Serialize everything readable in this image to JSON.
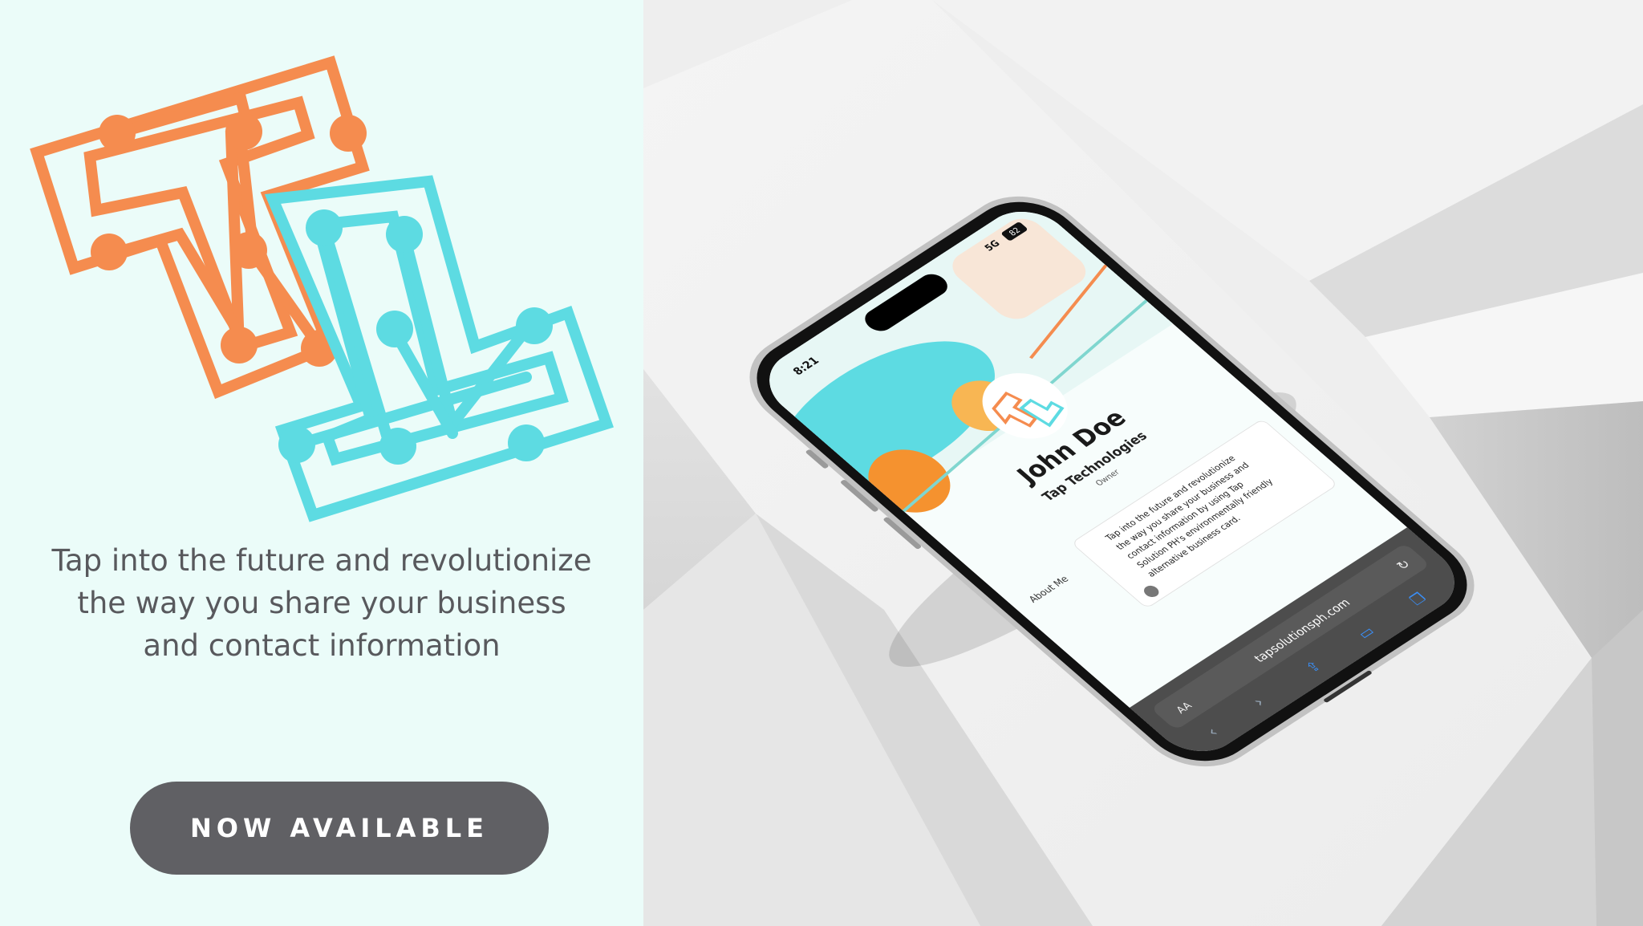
{
  "hero": {
    "tagline": "Tap into the future and revolutionize the way you share your business and contact information",
    "cta_label": "NOW AVAILABLE"
  },
  "colors": {
    "panel_bg": "#ebfcf9",
    "logo_orange": "#f58c4f",
    "logo_teal": "#5ddbe2",
    "button_bg": "#606064"
  },
  "phone": {
    "status_time": "8:21",
    "status_network": "5G",
    "status_battery": "82",
    "profile": {
      "name": "John Doe",
      "company": "Tap Technologies",
      "role": "Owner",
      "section_label": "About Me",
      "about_text": [
        "Tap into the future and revolutionize",
        "the way you share your business and",
        "contact information by using Tap",
        "Solution PH's environmentally friendly",
        "alternative business card."
      ]
    },
    "browser": {
      "text_size_label": "AA",
      "url": "tapsolutionsph.com"
    }
  }
}
